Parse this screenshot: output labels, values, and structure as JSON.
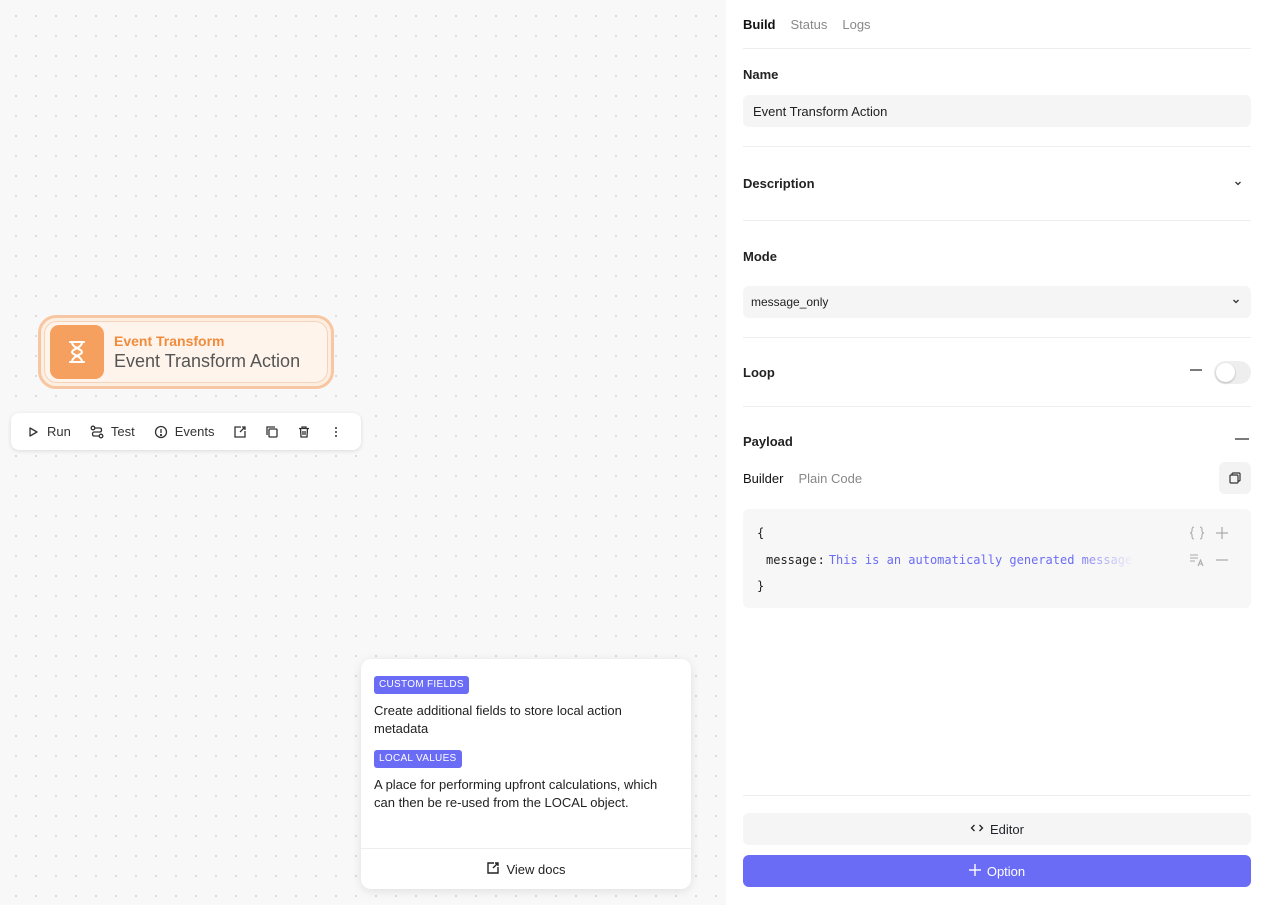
{
  "node": {
    "type_label": "Event Transform",
    "name": "Event Transform Action",
    "icon": "hourglass-icon"
  },
  "toolbar": {
    "run_label": "Run",
    "test_label": "Test",
    "events_label": "Events"
  },
  "docs": {
    "custom_fields_badge": "CUSTOM FIELDS",
    "custom_fields_text": "Create additional fields to store local action metadata",
    "local_values_badge": "LOCAL VALUES",
    "local_values_text": "A place for performing upfront calculations, which can then be re-used from the LOCAL object.",
    "view_docs_label": "View docs"
  },
  "panel": {
    "tabs": [
      {
        "label": "Build",
        "active": true
      },
      {
        "label": "Status",
        "active": false
      },
      {
        "label": "Logs",
        "active": false
      }
    ],
    "name_label": "Name",
    "name_value": "Event Transform Action",
    "description_label": "Description",
    "mode_label": "Mode",
    "mode_value": "message_only",
    "loop_label": "Loop",
    "loop_enabled": false,
    "payload_label": "Payload",
    "payload_tabs": [
      {
        "label": "Builder",
        "active": true
      },
      {
        "label": "Plain Code",
        "active": false
      }
    ],
    "code": {
      "open_brace": "{",
      "key": "message",
      "value": "This is an automatically generated message",
      "close_brace": "}"
    },
    "editor_label": "Editor",
    "option_label": "Option"
  },
  "colors": {
    "accent": "#6b6cf6",
    "node_orange": "#f5a05f",
    "code_string": "#6b6cf6"
  }
}
